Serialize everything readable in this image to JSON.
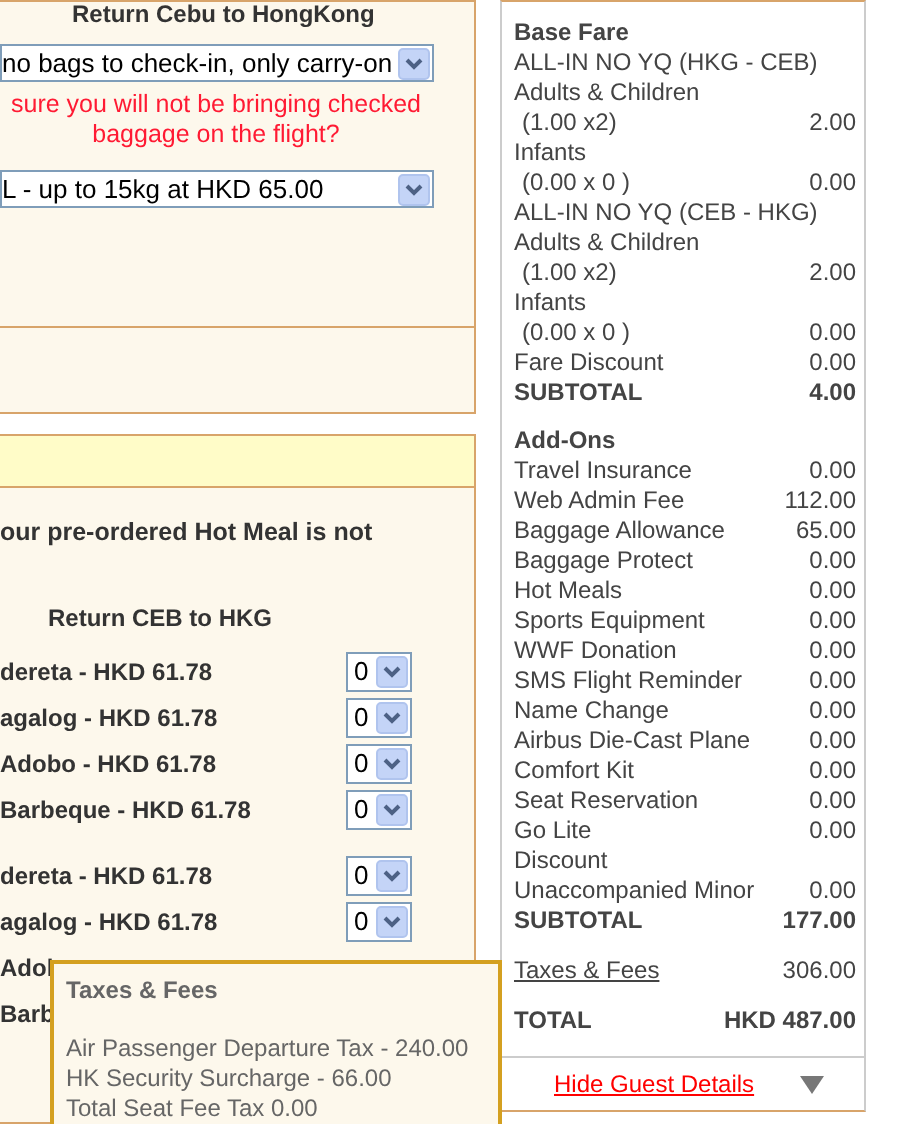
{
  "baggage": {
    "route_heading": "Return Cebu to HongKong",
    "carry_on_select": "no bags to check-in, only carry-on",
    "warning": "sure you will not be bringing checked baggage on the flight?",
    "allowance_select": "L - up to 15kg at HKD 65.00"
  },
  "meals": {
    "notice": "our pre-ordered Hot Meal is not",
    "heading": "Return CEB to HKG",
    "groups": [
      [
        {
          "label": "dereta - HKD 61.78",
          "qty": "0"
        },
        {
          "label": "agalog - HKD 61.78",
          "qty": "0"
        },
        {
          "label": "Adobo - HKD 61.78",
          "qty": "0"
        },
        {
          "label": "Barbeque - HKD 61.78",
          "qty": "0"
        }
      ],
      [
        {
          "label": "dereta - HKD 61.78",
          "qty": "0"
        },
        {
          "label": "agalog - HKD 61.78",
          "qty": "0"
        },
        {
          "label": "Adol"
        },
        {
          "label": "Barb"
        }
      ]
    ]
  },
  "summary": {
    "sections": [
      {
        "title": "Base Fare",
        "rows": [
          {
            "label": "ALL-IN NO YQ (HKG - CEB)"
          },
          {
            "label": "Adults & Children"
          },
          {
            "label": "(1.00 x2)",
            "amount": "2.00",
            "indent": true
          },
          {
            "label": "Infants"
          },
          {
            "label": "(0.00 x 0 )",
            "amount": "0.00",
            "indent": true
          },
          {
            "label": "ALL-IN NO YQ (CEB - HKG)"
          },
          {
            "label": "Adults & Children"
          },
          {
            "label": "(1.00 x2)",
            "amount": "2.00",
            "indent": true
          },
          {
            "label": "Infants"
          },
          {
            "label": "(0.00 x 0 )",
            "amount": "0.00",
            "indent": true
          },
          {
            "label": "Fare Discount",
            "amount": "0.00"
          }
        ],
        "subtotal_label": "SUBTOTAL",
        "subtotal": "4.00"
      },
      {
        "title": "Add-Ons",
        "rows": [
          {
            "label": "Travel Insurance",
            "amount": "0.00"
          },
          {
            "label": "Web Admin Fee",
            "amount": "112.00"
          },
          {
            "label": "Baggage Allowance",
            "amount": "65.00"
          },
          {
            "label": "Baggage Protect",
            "amount": "0.00"
          },
          {
            "label": "Hot Meals",
            "amount": "0.00"
          },
          {
            "label": "Sports Equipment",
            "amount": "0.00"
          },
          {
            "label": "WWF Donation",
            "amount": "0.00"
          },
          {
            "label": "SMS Flight Reminder",
            "amount": "0.00"
          },
          {
            "label": "Name Change",
            "amount": "0.00"
          },
          {
            "label": "Airbus Die-Cast Plane",
            "amount": "0.00"
          },
          {
            "label": "Comfort Kit",
            "amount": "0.00"
          },
          {
            "label": "Seat Reservation",
            "amount": "0.00"
          },
          {
            "label": "Go Lite",
            "amount": "0.00"
          },
          {
            "label": "Discount"
          },
          {
            "label": "Unaccompanied Minor",
            "amount": "0.00"
          }
        ],
        "subtotal_label": "SUBTOTAL",
        "subtotal": "177.00"
      }
    ],
    "taxes_label": "Taxes & Fees",
    "taxes_amount": "306.00",
    "total_label": "TOTAL",
    "total_amount": "HKD 487.00",
    "toggle_link": "Hide Guest Details"
  },
  "tooltip": {
    "title": "Taxes & Fees",
    "lines": [
      "Air Passenger Departure Tax  -  240.00",
      "HK Security Surcharge  -  66.00",
      "Total Seat Fee Tax 0.00"
    ]
  }
}
